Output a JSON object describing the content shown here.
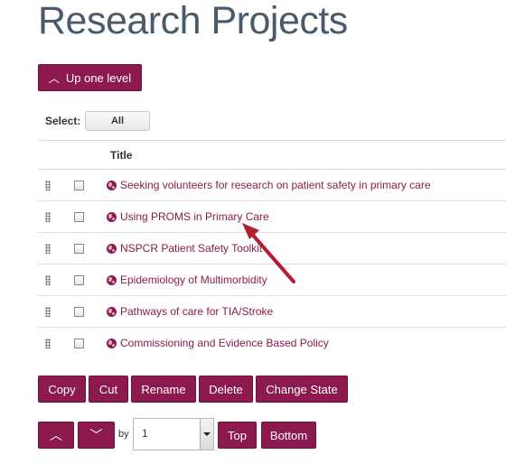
{
  "page": {
    "title": "Research Projects"
  },
  "nav": {
    "up_label": "Up one level"
  },
  "select": {
    "label": "Select:",
    "all_label": "All"
  },
  "table": {
    "title_header": "Title",
    "rows": [
      {
        "title": "Seeking volunteers for research on patient safety in primary care"
      },
      {
        "title": "Using PROMS in Primary Care"
      },
      {
        "title": "NSPCR Patient Safety Toolkit"
      },
      {
        "title": "Epidemiology of Multimorbidity"
      },
      {
        "title": "Pathways of care for TIA/Stroke"
      },
      {
        "title": "Commissioning and Evidence Based Policy"
      }
    ]
  },
  "actions": {
    "copy": "Copy",
    "cut": "Cut",
    "rename": "Rename",
    "delete": "Delete",
    "change_state": "Change State"
  },
  "move": {
    "by_label": "by",
    "amount": "1",
    "top": "Top",
    "bottom": "Bottom"
  },
  "colors": {
    "accent": "#8c1a4f",
    "title_gray": "#4a5a6a",
    "annotation_arrow": "#b0202e"
  }
}
